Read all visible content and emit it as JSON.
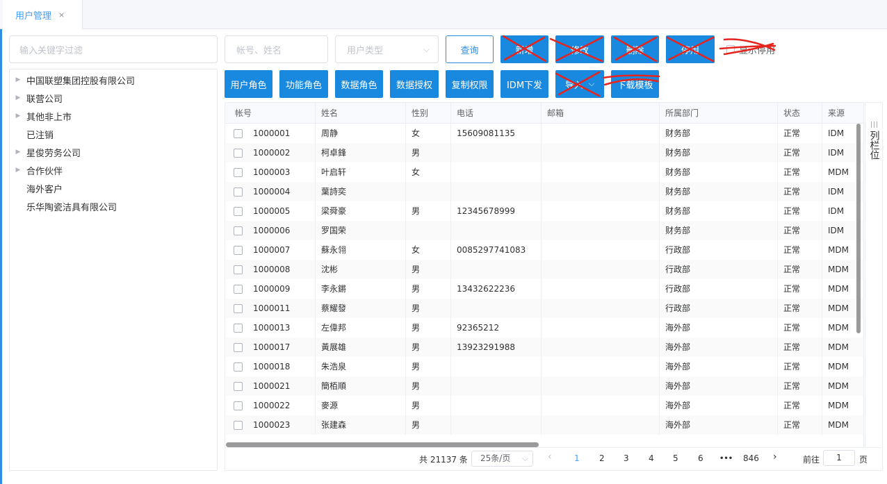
{
  "tab": {
    "label": "用户管理",
    "close": "×"
  },
  "sidebar": {
    "filter_placeholder": "输入关键字过滤",
    "nodes": [
      {
        "label": "中国联塑集团控股有限公司",
        "expandable": true
      },
      {
        "label": "联营公司",
        "expandable": true
      },
      {
        "label": "其他非上市",
        "expandable": true
      },
      {
        "label": "已注销",
        "expandable": false
      },
      {
        "label": "星俊劳务公司",
        "expandable": true
      },
      {
        "label": "合作伙伴",
        "expandable": true
      },
      {
        "label": "海外客户",
        "expandable": false
      },
      {
        "label": "乐华陶瓷洁具有限公司",
        "expandable": false
      }
    ]
  },
  "toolbar": {
    "search_placeholder": "帐号、姓名",
    "type_placeholder": "用户类型",
    "query": "查询",
    "add": "新增",
    "edit": "修改",
    "delete": "删除",
    "disable": "停用",
    "show_disabled": "显示停用",
    "user_role": "用户角色",
    "func_role": "功能角色",
    "data_role": "数据角色",
    "data_auth": "数据授权",
    "copy_perm": "复制权限",
    "idm_push": "IDM下发",
    "import": "导入",
    "download_template": "下载模板"
  },
  "table": {
    "headers": [
      "帐号",
      "姓名",
      "性别",
      "电话",
      "邮箱",
      "所属部门",
      "状态",
      "来源"
    ],
    "rows": [
      [
        "1000001",
        "周静",
        "女",
        "15609081135",
        "",
        "财务部",
        "正常",
        "IDM"
      ],
      [
        "1000002",
        "柯卓鋒",
        "男",
        "",
        "",
        "财务部",
        "正常",
        "IDM"
      ],
      [
        "1000003",
        "叶启轩",
        "女",
        "",
        "",
        "财务部",
        "正常",
        "MDM"
      ],
      [
        "1000004",
        "葉詩奕",
        "",
        "",
        "",
        "财务部",
        "正常",
        "IDM"
      ],
      [
        "1000005",
        "梁舜豪",
        "男",
        "12345678999",
        "",
        "财务部",
        "正常",
        "IDM"
      ],
      [
        "1000006",
        "罗国荣",
        "",
        "",
        "",
        "财务部",
        "正常",
        "IDM"
      ],
      [
        "1000007",
        "蘇永翎",
        "女",
        "0085297741083",
        "",
        "行政部",
        "正常",
        "MDM"
      ],
      [
        "1000008",
        "沈彬",
        "男",
        "",
        "",
        "行政部",
        "正常",
        "MDM"
      ],
      [
        "1000009",
        "李永鏘",
        "男",
        "13432622236",
        "",
        "行政部",
        "正常",
        "MDM"
      ],
      [
        "1000011",
        "蔡耀發",
        "男",
        "",
        "",
        "行政部",
        "正常",
        "MDM"
      ],
      [
        "1000013",
        "左偉邦",
        "男",
        "92365212",
        "",
        "海外部",
        "正常",
        "MDM"
      ],
      [
        "1000017",
        "黃展雄",
        "男",
        "13923291988",
        "",
        "海外部",
        "正常",
        "MDM"
      ],
      [
        "1000018",
        "朱浩泉",
        "男",
        "",
        "",
        "海外部",
        "正常",
        "MDM"
      ],
      [
        "1000021",
        "簡栢順",
        "男",
        "",
        "",
        "海外部",
        "正常",
        "MDM"
      ],
      [
        "1000022",
        "麥源",
        "男",
        "",
        "",
        "海外部",
        "正常",
        "MDM"
      ],
      [
        "1000023",
        "张建森",
        "男",
        "",
        "",
        "海外部",
        "正常",
        "MDM"
      ]
    ],
    "column_settings": "列栏位"
  },
  "pagination": {
    "total": "共 21137 条",
    "page_size": "25条/页",
    "pages": [
      "1",
      "2",
      "3",
      "4",
      "5",
      "6"
    ],
    "ellipsis": "•••",
    "last_page": "846",
    "current": "1",
    "prev": "‹",
    "next": "›",
    "goto_prefix": "前往",
    "goto_value": "1",
    "goto_suffix": "页"
  },
  "colors": {
    "primary": "#1989e0",
    "link": "#409eff",
    "strike": "#e8231c"
  }
}
